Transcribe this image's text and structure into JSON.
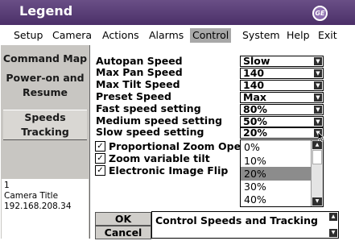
{
  "window": {
    "title": "Legend",
    "logo_text": "GE"
  },
  "menu": [
    {
      "label": "Setup"
    },
    {
      "label": "Camera"
    },
    {
      "label": "Actions"
    },
    {
      "label": "Alarms"
    },
    {
      "label": "Control",
      "active": true
    },
    {
      "label": "System"
    },
    {
      "label": "Help"
    },
    {
      "label": "Exit"
    }
  ],
  "sidebar": {
    "items": [
      {
        "label": "Command Map"
      },
      {
        "label_line1": "Power-on and",
        "label_line2": "Resume"
      },
      {
        "label_line1": "Speeds",
        "label_line2": "Tracking",
        "selected": true
      }
    ],
    "info": {
      "line1": "1",
      "line2": "Camera Title",
      "line3": "192.168.208.34"
    }
  },
  "fields": [
    {
      "label": "Autopan Speed",
      "value": "Slow"
    },
    {
      "label": "Max Pan Speed",
      "value": "140"
    },
    {
      "label": "Max Tilt Speed",
      "value": "140"
    },
    {
      "label": "Preset Speed",
      "value": "Max"
    },
    {
      "label": "Fast speed setting",
      "value": "80%"
    },
    {
      "label": "Medium speed setting",
      "value": "50%"
    },
    {
      "label": "Slow speed setting",
      "value": "20%"
    }
  ],
  "checkboxes": [
    {
      "label": "Proportional Zoom Opera",
      "checked": true
    },
    {
      "label": "Zoom variable tilt",
      "checked": true
    },
    {
      "label": "Electronic Image Flip",
      "checked": true
    }
  ],
  "dropdown": {
    "options": [
      "0%",
      "10%",
      "20%",
      "30%",
      "40%"
    ],
    "selected": "20%"
  },
  "buttons": {
    "ok": "OK",
    "cancel": "Cancel"
  },
  "description": "Control Speeds and Tracking",
  "icons": {
    "arrow_down": "chevron-down-icon",
    "arrow_up": "chevron-up-icon",
    "check": "check-icon"
  },
  "colors": {
    "titlebar": "#4b2f68",
    "sidebar": "#c8c6c2",
    "active_menu": "#a8a8a8",
    "selected_option": "#8c8c8c"
  }
}
